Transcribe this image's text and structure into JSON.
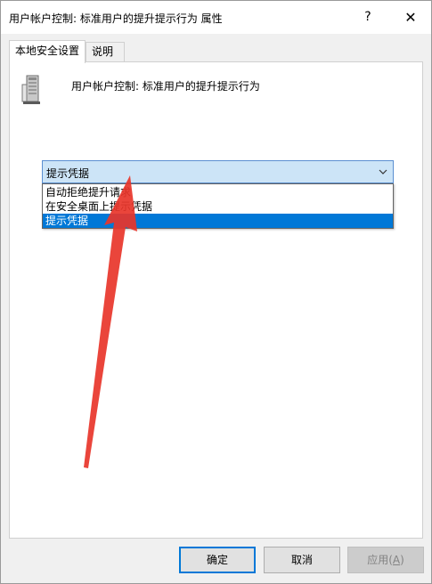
{
  "window": {
    "title": "用户帐户控制: 标准用户的提升提示行为 属性",
    "help_label": "?",
    "close_label": "✕"
  },
  "tabs": [
    {
      "label": "本地安全设置",
      "active": true
    },
    {
      "label": "说明",
      "active": false
    }
  ],
  "policy": {
    "title": "用户帐户控制: 标准用户的提升提示行为",
    "icon": "server-policy-icon"
  },
  "combo": {
    "selected_value": "提示凭据",
    "options": [
      {
        "label": "自动拒绝提升请求",
        "selected": false
      },
      {
        "label": "在安全桌面上提示凭据",
        "selected": false
      },
      {
        "label": "提示凭据",
        "selected": true
      }
    ]
  },
  "buttons": {
    "ok_label": "确定",
    "cancel_label": "取消",
    "apply_label_main": "应用(",
    "apply_accel": "A",
    "apply_label_end": ")"
  },
  "colors": {
    "selection": "#0078d7",
    "annotation_arrow": "#e8352a"
  }
}
